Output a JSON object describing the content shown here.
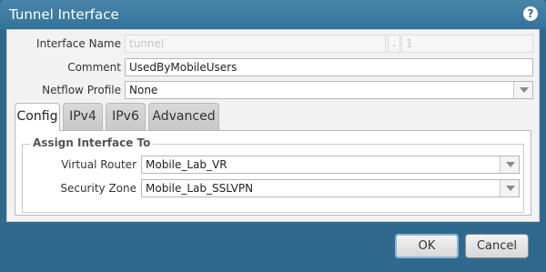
{
  "dialog": {
    "title": "Tunnel Interface",
    "help_icon": "help-icon"
  },
  "form": {
    "interface_name_label": "Interface Name",
    "interface_name_value": "tunnel",
    "interface_sep": ".",
    "interface_unit_value": "1",
    "comment_label": "Comment",
    "comment_value": "UsedByMobileUsers",
    "netflow_label": "Netflow Profile",
    "netflow_value": "None"
  },
  "tabs": [
    {
      "label": "Config",
      "active": true
    },
    {
      "label": "IPv4",
      "active": false
    },
    {
      "label": "IPv6",
      "active": false
    },
    {
      "label": "Advanced",
      "active": false
    }
  ],
  "config": {
    "legend": "Assign Interface To",
    "virtual_router_label": "Virtual Router",
    "virtual_router_value": "Mobile_Lab_VR",
    "security_zone_label": "Security Zone",
    "security_zone_value": "Mobile_Lab_SSLVPN"
  },
  "footer": {
    "ok_label": "OK",
    "cancel_label": "Cancel"
  },
  "colors": {
    "frame": "#2f6a8e",
    "body_bg": "#f2f2f2"
  }
}
